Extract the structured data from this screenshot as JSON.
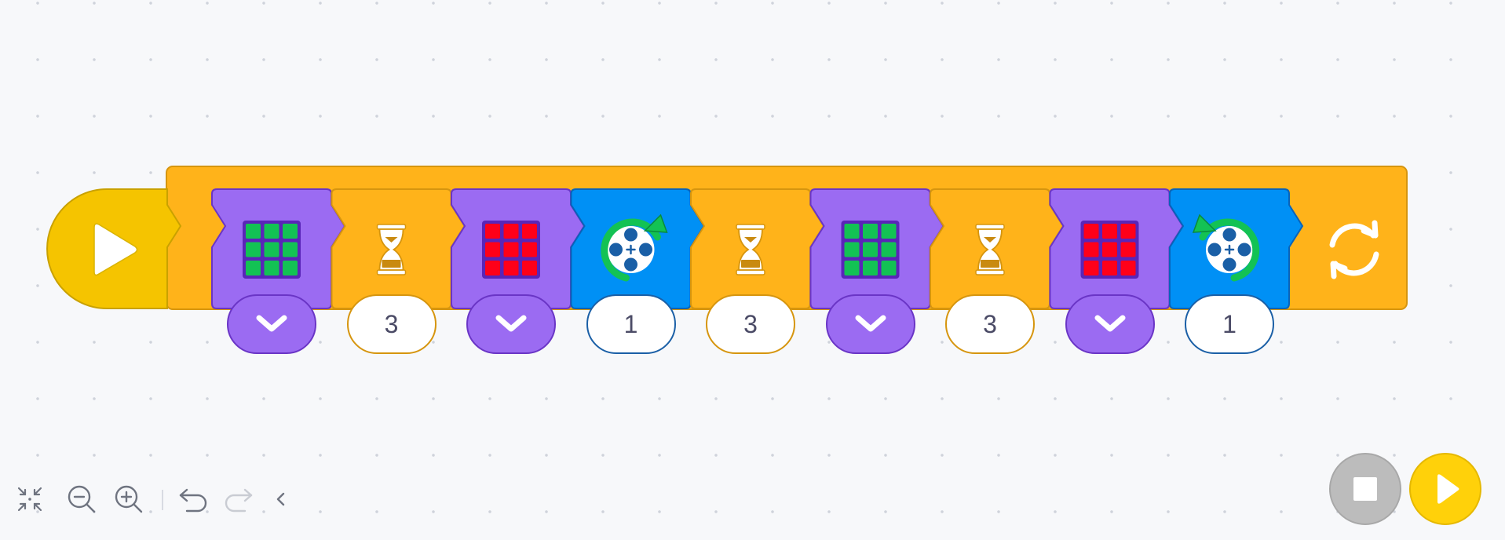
{
  "app": {
    "colors": {
      "background": "#f7f8fa",
      "start_block": "#f5c400",
      "loop_block": "#ffb31a",
      "light_block": "#9b6bf2",
      "wait_block": "#ffb31a",
      "motor_block": "#0090f5",
      "green_light": "#13c254",
      "red_light": "#ff0019",
      "motor_arrow": "#13c254",
      "motor_hub": "#1a5fa6"
    }
  },
  "program": {
    "start_block": {
      "icon": "play-triangle-icon"
    },
    "loop_block": {
      "icon": "repeat-forever-icon"
    },
    "blocks": [
      {
        "type": "light",
        "icon": "light-matrix-icon",
        "light_color": "#13c254",
        "param": "dropdown"
      },
      {
        "type": "wait",
        "icon": "hourglass-icon",
        "value": "3"
      },
      {
        "type": "light",
        "icon": "light-matrix-icon",
        "light_color": "#ff0019",
        "param": "dropdown"
      },
      {
        "type": "motor",
        "icon": "motor-rotate-clockwise-icon",
        "direction": "clockwise",
        "value": "1"
      },
      {
        "type": "wait",
        "icon": "hourglass-icon",
        "value": "3"
      },
      {
        "type": "light",
        "icon": "light-matrix-icon",
        "light_color": "#13c254",
        "param": "dropdown"
      },
      {
        "type": "wait",
        "icon": "hourglass-icon",
        "value": "3"
      },
      {
        "type": "light",
        "icon": "light-matrix-icon",
        "light_color": "#ff0019",
        "param": "dropdown"
      },
      {
        "type": "motor",
        "icon": "motor-rotate-counterclockwise-icon",
        "direction": "counterclockwise",
        "value": "1"
      }
    ]
  },
  "toolbar": {
    "items": [
      {
        "name": "fit-to-screen",
        "icon": "shrink-arrows-icon"
      },
      {
        "name": "zoom-out",
        "icon": "zoom-out-icon"
      },
      {
        "name": "zoom-in",
        "icon": "zoom-in-icon"
      },
      {
        "name": "undo",
        "icon": "undo-icon"
      },
      {
        "name": "redo",
        "icon": "redo-icon",
        "disabled": true
      },
      {
        "name": "collapse",
        "icon": "chevron-left-icon"
      }
    ]
  },
  "controls": {
    "stop": {
      "icon": "stop-square-icon"
    },
    "run": {
      "icon": "play-triangle-icon"
    }
  }
}
